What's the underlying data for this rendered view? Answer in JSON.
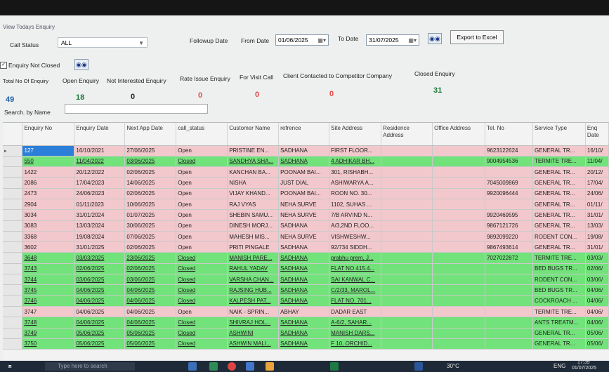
{
  "window": {
    "title": "View Todays Enquiry"
  },
  "filters": {
    "call_status_label": "Call Status",
    "call_status_value": "ALL",
    "followup_label": "Followup Date",
    "from_label": "From Date",
    "from_value": "01/06/2025",
    "to_label": "To Date",
    "to_value": "31/07/2025",
    "export_label": "Export to Excel",
    "enquiry_not_closed": "Enquiry Not Closed",
    "search_label": "Search. by Name"
  },
  "summary": [
    {
      "label": "Total No Of Enquiry",
      "count": "49",
      "color": "#1f5fa8"
    },
    {
      "label": "Open Enquiry",
      "count": "18",
      "color": "#1a7a3a"
    },
    {
      "label": "Not Interested Enquiry",
      "count": "0",
      "color": "#222222"
    },
    {
      "label": "Rate Issue Enquiry",
      "count": "0",
      "color": "#e04a4a"
    },
    {
      "label": "For Visit Call",
      "count": "0",
      "color": "#e04a4a"
    },
    {
      "label": "Client Contacted to Competitor Company",
      "count": "0",
      "color": "#e04a4a"
    },
    {
      "label": "Closed Enquiry",
      "count": "31",
      "color": "#1a7a3a"
    }
  ],
  "table": {
    "columns": [
      "Enquiry No",
      "Enquiry Date",
      "Next App Date",
      "call_status",
      "Customer Name",
      "refrence",
      "Site Address",
      "Residence Address",
      "Office Address",
      "Tel. No",
      "Service Type",
      "Enq Date"
    ],
    "rows": [
      {
        "no": "127",
        "date": "16/10/2021",
        "next": "27/06/2025",
        "status": "Open",
        "name": "PRISTINE EN...",
        "ref": "SADHANA",
        "site": "FIRST FLOOR...",
        "tel": "9623122624",
        "service": "GENERAL TR...",
        "enq": "16/10/",
        "tone": "pink"
      },
      {
        "no": "550",
        "date": "11/04/2022",
        "next": "03/06/2025",
        "status": "Closed",
        "name": "SANDHYA SHA...",
        "ref": "SADHANA",
        "site": "4 ADHIKAR BH...",
        "tel": "9004954536",
        "service": "TERMITE TRE...",
        "enq": "11/04/",
        "tone": "green"
      },
      {
        "no": "1422",
        "date": "20/12/2022",
        "next": "02/06/2025",
        "status": "Open",
        "name": "KANCHAN BA...",
        "ref": "POONAM BAI...",
        "site": "301, RISHABH...",
        "tel": "",
        "service": "GENERAL TR...",
        "enq": "20/12/",
        "tone": "pink"
      },
      {
        "no": "2086",
        "date": "17/04/2023",
        "next": "14/06/2025",
        "status": "Open",
        "name": "NISHA",
        "ref": "JUST DIAL",
        "site": "ASHIWARYA A...",
        "tel": "7045009869",
        "service": "GENERAL TR...",
        "enq": "17/04/",
        "tone": "pink"
      },
      {
        "no": "2473",
        "date": "24/06/2023",
        "next": "02/06/2025",
        "status": "Open",
        "name": "VIJAY KHAND...",
        "ref": "POONAM BAI...",
        "site": "ROON NO. 30...",
        "tel": "9920096444",
        "service": "GENERAL TR...",
        "enq": "24/06/",
        "tone": "pink"
      },
      {
        "no": "2904",
        "date": "01/11/2023",
        "next": "10/06/2025",
        "status": "Open",
        "name": "RAJ VYAS",
        "ref": "NEHA SURVE",
        "site": "1102, SUHAS ...",
        "tel": "",
        "service": "GENERAL TR...",
        "enq": "01/11/",
        "tone": "pink"
      },
      {
        "no": "3034",
        "date": "31/01/2024",
        "next": "01/07/2025",
        "status": "Open",
        "name": "SHEBIN SAMU...",
        "ref": "NEHA SURVE",
        "site": "7/B ARVIND N...",
        "tel": "9920469595",
        "service": "GENERAL TR...",
        "enq": "31/01/",
        "tone": "pink"
      },
      {
        "no": "3083",
        "date": "13/03/2024",
        "next": "30/06/2025",
        "status": "Open",
        "name": "DINESH MORJ...",
        "ref": "SADHANA",
        "site": "A/3,2ND FLOO...",
        "tel": "9867121726",
        "service": "GENERAL TR...",
        "enq": "13/03/",
        "tone": "pink"
      },
      {
        "no": "3368",
        "date": "19/08/2024",
        "next": "07/06/2025",
        "status": "Open",
        "name": "MAHESH MIS...",
        "ref": "NEHA SURVE",
        "site": "VISHWESHW...",
        "tel": "9892099220",
        "service": "RODENT CON...",
        "enq": "19/08/",
        "tone": "pink"
      },
      {
        "no": "3602",
        "date": "31/01/2025",
        "next": "02/06/2025",
        "status": "Open",
        "name": "PRITI PINGALE",
        "ref": "SADHANA",
        "site": "92/734 SIDDH...",
        "tel": "9867493614",
        "service": "GENERAL TR...",
        "enq": "31/01/",
        "tone": "pink"
      },
      {
        "no": "3648",
        "date": "03/03/2025",
        "next": "23/06/2025",
        "status": "Closed",
        "name": "MANISH PARE...",
        "ref": "SADHANA",
        "site": "prabhu prem, J...",
        "tel": "7027022872",
        "service": "TERMITE TRE...",
        "enq": "03/03/",
        "tone": "green"
      },
      {
        "no": "3743",
        "date": "02/06/2025",
        "next": "02/06/2025",
        "status": "Closed",
        "name": "RAHUL YADAV",
        "ref": "SADHANA",
        "site": "FLAT NO 415.4...",
        "tel": "",
        "service": "BED BUGS TR...",
        "enq": "02/06/",
        "tone": "green"
      },
      {
        "no": "3744",
        "date": "03/06/2025",
        "next": "03/06/2025",
        "status": "Closed",
        "name": "VARSHA CHAN...",
        "ref": "SADHANA",
        "site": "SAI KANWAL C...",
        "tel": "",
        "service": "RODENT CON...",
        "enq": "03/06/",
        "tone": "green"
      },
      {
        "no": "3745",
        "date": "04/06/2025",
        "next": "04/06/2025",
        "status": "Closed",
        "name": "RAJSING HUB...",
        "ref": "SADHANA",
        "site": "C/2/33, MAROL...",
        "tel": "",
        "service": "BED BUGS TR...",
        "enq": "04/06/",
        "tone": "green"
      },
      {
        "no": "3746",
        "date": "04/06/2025",
        "next": "04/06/2025",
        "status": "Closed",
        "name": "KALPESH PAT...",
        "ref": "SADHANA",
        "site": "FLAT NO. 701...",
        "tel": "",
        "service": "COCKROACH ...",
        "enq": "04/06/",
        "tone": "green"
      },
      {
        "no": "3747",
        "date": "04/06/2025",
        "next": "04/06/2025",
        "status": "Open",
        "name": "NAIK - SPRIN...",
        "ref": "ABHAY",
        "site": "DADAR EAST",
        "tel": "",
        "service": "TERMITE TRE...",
        "enq": "04/06/",
        "tone": "pink"
      },
      {
        "no": "3748",
        "date": "04/06/2025",
        "next": "04/06/2025",
        "status": "Closed",
        "name": "SHIVRAJ HOL...",
        "ref": "SADHANA",
        "site": "A-6/2, SAHAR...",
        "tel": "",
        "service": "ANTS TREATM...",
        "enq": "04/06/",
        "tone": "green"
      },
      {
        "no": "3749",
        "date": "05/06/2025",
        "next": "05/06/2025",
        "status": "Closed",
        "name": "ASHWINI",
        "ref": "SADHANA",
        "site": "MANISH DARS...",
        "tel": "",
        "service": "GENERAL TR...",
        "enq": "05/06/",
        "tone": "green"
      },
      {
        "no": "3750",
        "date": "05/06/2025",
        "next": "05/06/2025",
        "status": "Closed",
        "name": "ASHWIN MALI...",
        "ref": "SADHANA",
        "site": "F 10, ORCHID...",
        "tel": "",
        "service": "GENERAL TR...",
        "enq": "05/06/",
        "tone": "green"
      }
    ]
  },
  "taskbar": {
    "search_placeholder": "Type here to search",
    "weather": "30°C",
    "lang": "ENG",
    "time": "17:39",
    "date": "01/07/2025"
  }
}
